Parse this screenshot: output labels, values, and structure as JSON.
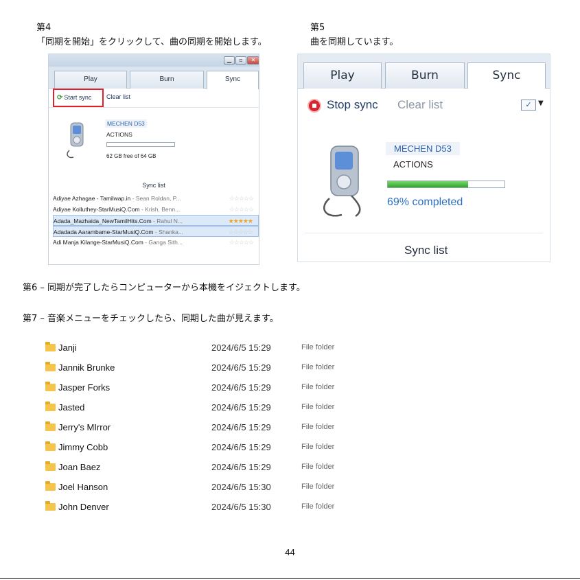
{
  "step4": {
    "heading": "第4",
    "instruction": "「同期を開始」をクリックして、曲の同期を開始します。",
    "tabs": [
      "Play",
      "Burn",
      "Sync"
    ],
    "start_sync": "Start sync",
    "clear_list": "Clear list",
    "device_name": "MECHEN D53",
    "device_status": "ACTIONS",
    "free_space": "62 GB free of 64 GB",
    "sync_list_title": "Sync list",
    "tracks": [
      {
        "name": "Adiyae Azhagae - Tamilwap.in",
        "artist": " - Sean Roldan, P...",
        "stars": 0,
        "selected": false
      },
      {
        "name": "Adiyae Kolluthey-StarMusiQ.Com",
        "artist": " - Krish, Benn...",
        "stars": 0,
        "selected": false
      },
      {
        "name": "Adada_Mazhaida_NewTamilHits.Com",
        "artist": " - Rahul N...",
        "stars": 5,
        "selected": true
      },
      {
        "name": "Adadada Aarambame-StarMusiQ.Com",
        "artist": " - Shanka...",
        "stars": 0,
        "selected": true
      },
      {
        "name": "Adi Manja Kilange-StarMusiQ.Com",
        "artist": " - Ganga Sith...",
        "stars": 0,
        "selected": false
      }
    ]
  },
  "step5": {
    "heading": "第5",
    "instruction": "曲を同期しています。",
    "tabs": [
      "Play",
      "Burn",
      "Sync"
    ],
    "stop_sync": "Stop sync",
    "clear_list": "Clear list",
    "device_name": "MECHEN D53",
    "device_status": "ACTIONS",
    "progress_fraction": 0.69,
    "progress_text": "69% completed",
    "sync_list_title": "Sync list"
  },
  "step6": {
    "text": "第6 – 同期が完了したらコンピューターから本機をイジェクトします。"
  },
  "step7": {
    "text": "第7 – 音楽メニューをチェックしたら、同期した曲が見えます。"
  },
  "files": [
    {
      "name": "Janji",
      "date": "2024/6/5 15:29",
      "type": "File folder"
    },
    {
      "name": "Jannik Brunke",
      "date": "2024/6/5 15:29",
      "type": "File folder"
    },
    {
      "name": "Jasper Forks",
      "date": "2024/6/5 15:29",
      "type": "File folder"
    },
    {
      "name": "Jasted",
      "date": "2024/6/5 15:29",
      "type": "File folder"
    },
    {
      "name": "Jerry's MIrror",
      "date": "2024/6/5 15:29",
      "type": "File folder"
    },
    {
      "name": "Jimmy Cobb",
      "date": "2024/6/5 15:29",
      "type": "File folder"
    },
    {
      "name": "Joan Baez",
      "date": "2024/6/5 15:29",
      "type": "File folder"
    },
    {
      "name": "Joel Hanson",
      "date": "2024/6/5 15:30",
      "type": "File folder"
    },
    {
      "name": "John Denver",
      "date": "2024/6/5 15:30",
      "type": "File folder"
    }
  ],
  "page_number": "44",
  "colors": {
    "highlight_box": "#e0202a",
    "progress": "#2fa52b",
    "accent_blue": "#2a5ea8"
  }
}
